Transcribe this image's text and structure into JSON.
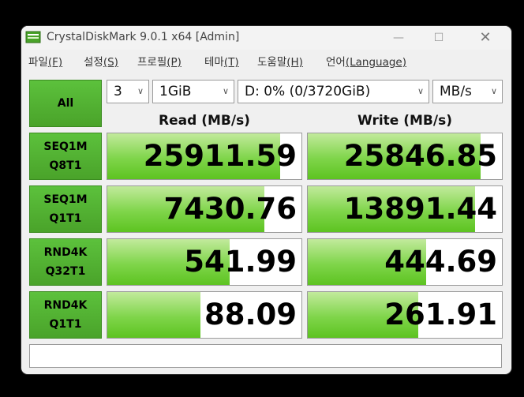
{
  "window": {
    "title": "CrystalDiskMark 9.0.1 x64 [Admin]",
    "minimize_glyph": "—",
    "maximize_glyph": "☐",
    "close_glyph": "✕"
  },
  "menu": [
    {
      "label": "파일",
      "key": "(F)"
    },
    {
      "label": "설정",
      "key": "(S)"
    },
    {
      "label": "프로필",
      "key": "(P)"
    },
    {
      "label": "테마",
      "key": "(T)"
    },
    {
      "label": "도움말",
      "key": "(H)"
    },
    {
      "label": "언어",
      "key": "(Language)"
    }
  ],
  "controls": {
    "all_label": "All",
    "count": "3",
    "size": "1GiB",
    "drive": "D: 0% (0/3720GiB)",
    "unit": "MB/s",
    "chevron": "∨"
  },
  "headers": {
    "read": "Read (MB/s)",
    "write": "Write (MB/s)"
  },
  "tests": [
    {
      "line1": "SEQ1M",
      "line2": "Q8T1",
      "read": "25911.59",
      "write": "25846.85",
      "read_fill": 0.89,
      "write_fill": 0.89
    },
    {
      "line1": "SEQ1M",
      "line2": "Q1T1",
      "read": "7430.76",
      "write": "13891.44",
      "read_fill": 0.81,
      "write_fill": 0.86
    },
    {
      "line1": "RND4K",
      "line2": "Q32T1",
      "read": "541.99",
      "write": "444.69",
      "read_fill": 0.63,
      "write_fill": 0.61
    },
    {
      "line1": "RND4K",
      "line2": "Q1T1",
      "read": "88.09",
      "write": "261.91",
      "read_fill": 0.48,
      "write_fill": 0.57
    }
  ],
  "comment": "",
  "colors": {
    "accent_green": "#4aa32a",
    "bar_green": "#7fd54a"
  }
}
